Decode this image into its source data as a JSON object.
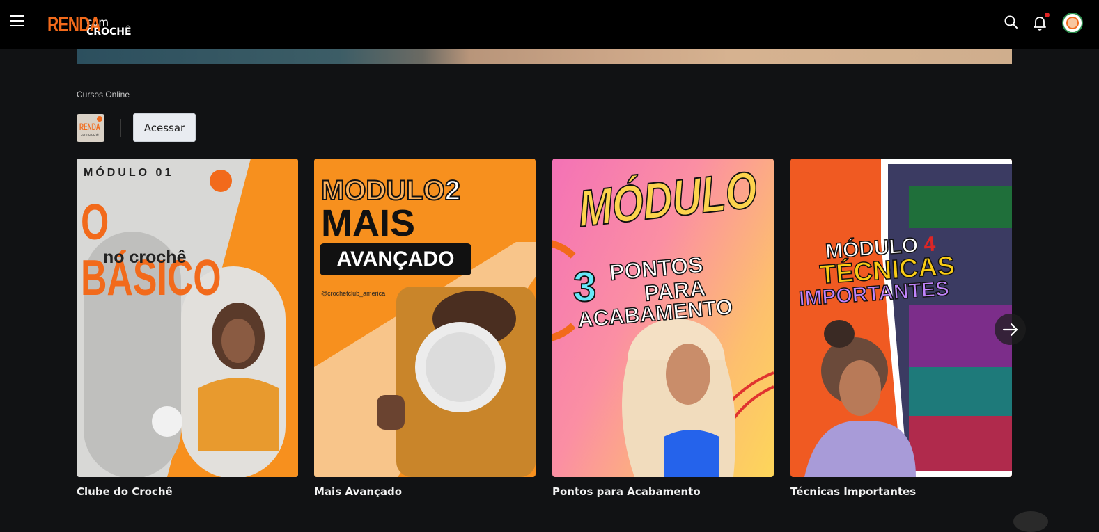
{
  "header": {
    "logo": {
      "renda": "RENDA",
      "com": "com",
      "croche": "CROCHÊ"
    },
    "icons": [
      "menu-icon",
      "search-icon",
      "bell-icon",
      "avatar"
    ],
    "notification_dot_color": "#e02424"
  },
  "section": {
    "title": "Cursos Online",
    "course_logo": {
      "renda": "RENDA",
      "sub": "com crochê"
    },
    "access_button": "Acessar"
  },
  "cards": [
    {
      "title": "Clube do Crochê",
      "art": {
        "line1": "MÓDULO 01",
        "line2": "O BÁSICO",
        "line3": "no crochê"
      }
    },
    {
      "title": "Mais Avançado",
      "art": {
        "line1": "MODULO",
        "num": "2",
        "line2": "MAIS",
        "line3": "AVANÇADO",
        "handle": "@crochetclub_america"
      }
    },
    {
      "title": "Pontos para Acabamento",
      "art": {
        "line1": "MÓDULO",
        "num": "3",
        "line2": "PONTOS",
        "line3": "PARA",
        "line4": "ACABAMENTO"
      }
    },
    {
      "title": "Técnicas Importantes",
      "art": {
        "line1": "MÓDULO",
        "num": "4",
        "line2": "TÉCNICAS",
        "line3": "IMPORTANTES"
      }
    }
  ],
  "colors": {
    "brand_orange": "#f26a1b",
    "background": "#111214",
    "topbar": "#000000"
  }
}
